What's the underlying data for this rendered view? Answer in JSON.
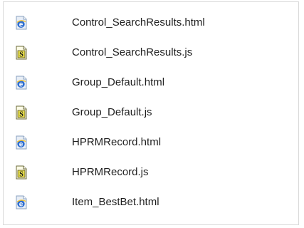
{
  "files": [
    {
      "name": "Control_SearchResults.html",
      "icon": "html-file-icon"
    },
    {
      "name": "Control_SearchResults.js",
      "icon": "js-file-icon"
    },
    {
      "name": "Group_Default.html",
      "icon": "html-file-icon"
    },
    {
      "name": "Group_Default.js",
      "icon": "js-file-icon"
    },
    {
      "name": "HPRMRecord.html",
      "icon": "html-file-icon"
    },
    {
      "name": "HPRMRecord.js",
      "icon": "js-file-icon"
    },
    {
      "name": "Item_BestBet.html",
      "icon": "html-file-icon"
    }
  ]
}
